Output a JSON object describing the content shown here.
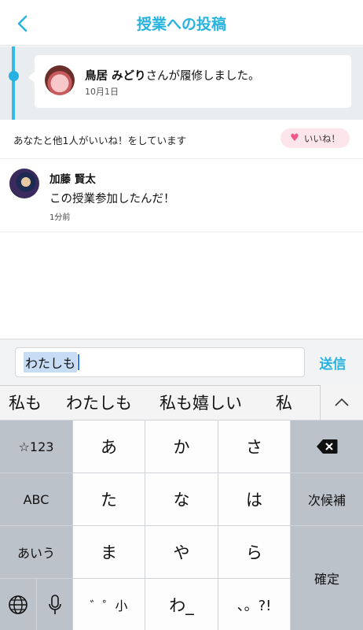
{
  "header": {
    "title": "授業への投稿"
  },
  "timeline": {
    "name": "鳥居 みどり",
    "message": "さんが履修しました。",
    "date": "10月1日"
  },
  "likes": {
    "summary": "あなたと他1人がいいね！をしています",
    "button_label": "いいね！"
  },
  "comment": {
    "author": "加藤 賢太",
    "text": "この授業参加したんだ！",
    "time": "1分前"
  },
  "composer": {
    "value": "わたしも",
    "send_label": "送信"
  },
  "candidates": [
    "私も",
    "わたしも",
    "私も嬉しい",
    "私",
    "「"
  ],
  "keyboard": {
    "rows": [
      [
        "☆123",
        "あ",
        "か",
        "さ",
        ""
      ],
      [
        "ABC",
        "た",
        "な",
        "は",
        "次候補"
      ],
      [
        "あいう",
        "ま",
        "や",
        "ら",
        "確定"
      ],
      [
        "",
        "",
        "゛゜小",
        "わ_",
        "、。?!"
      ]
    ]
  },
  "colors": {
    "accent": "#29b3df",
    "like_pill": "#fde5ec",
    "heart": "#ee5a8a"
  }
}
